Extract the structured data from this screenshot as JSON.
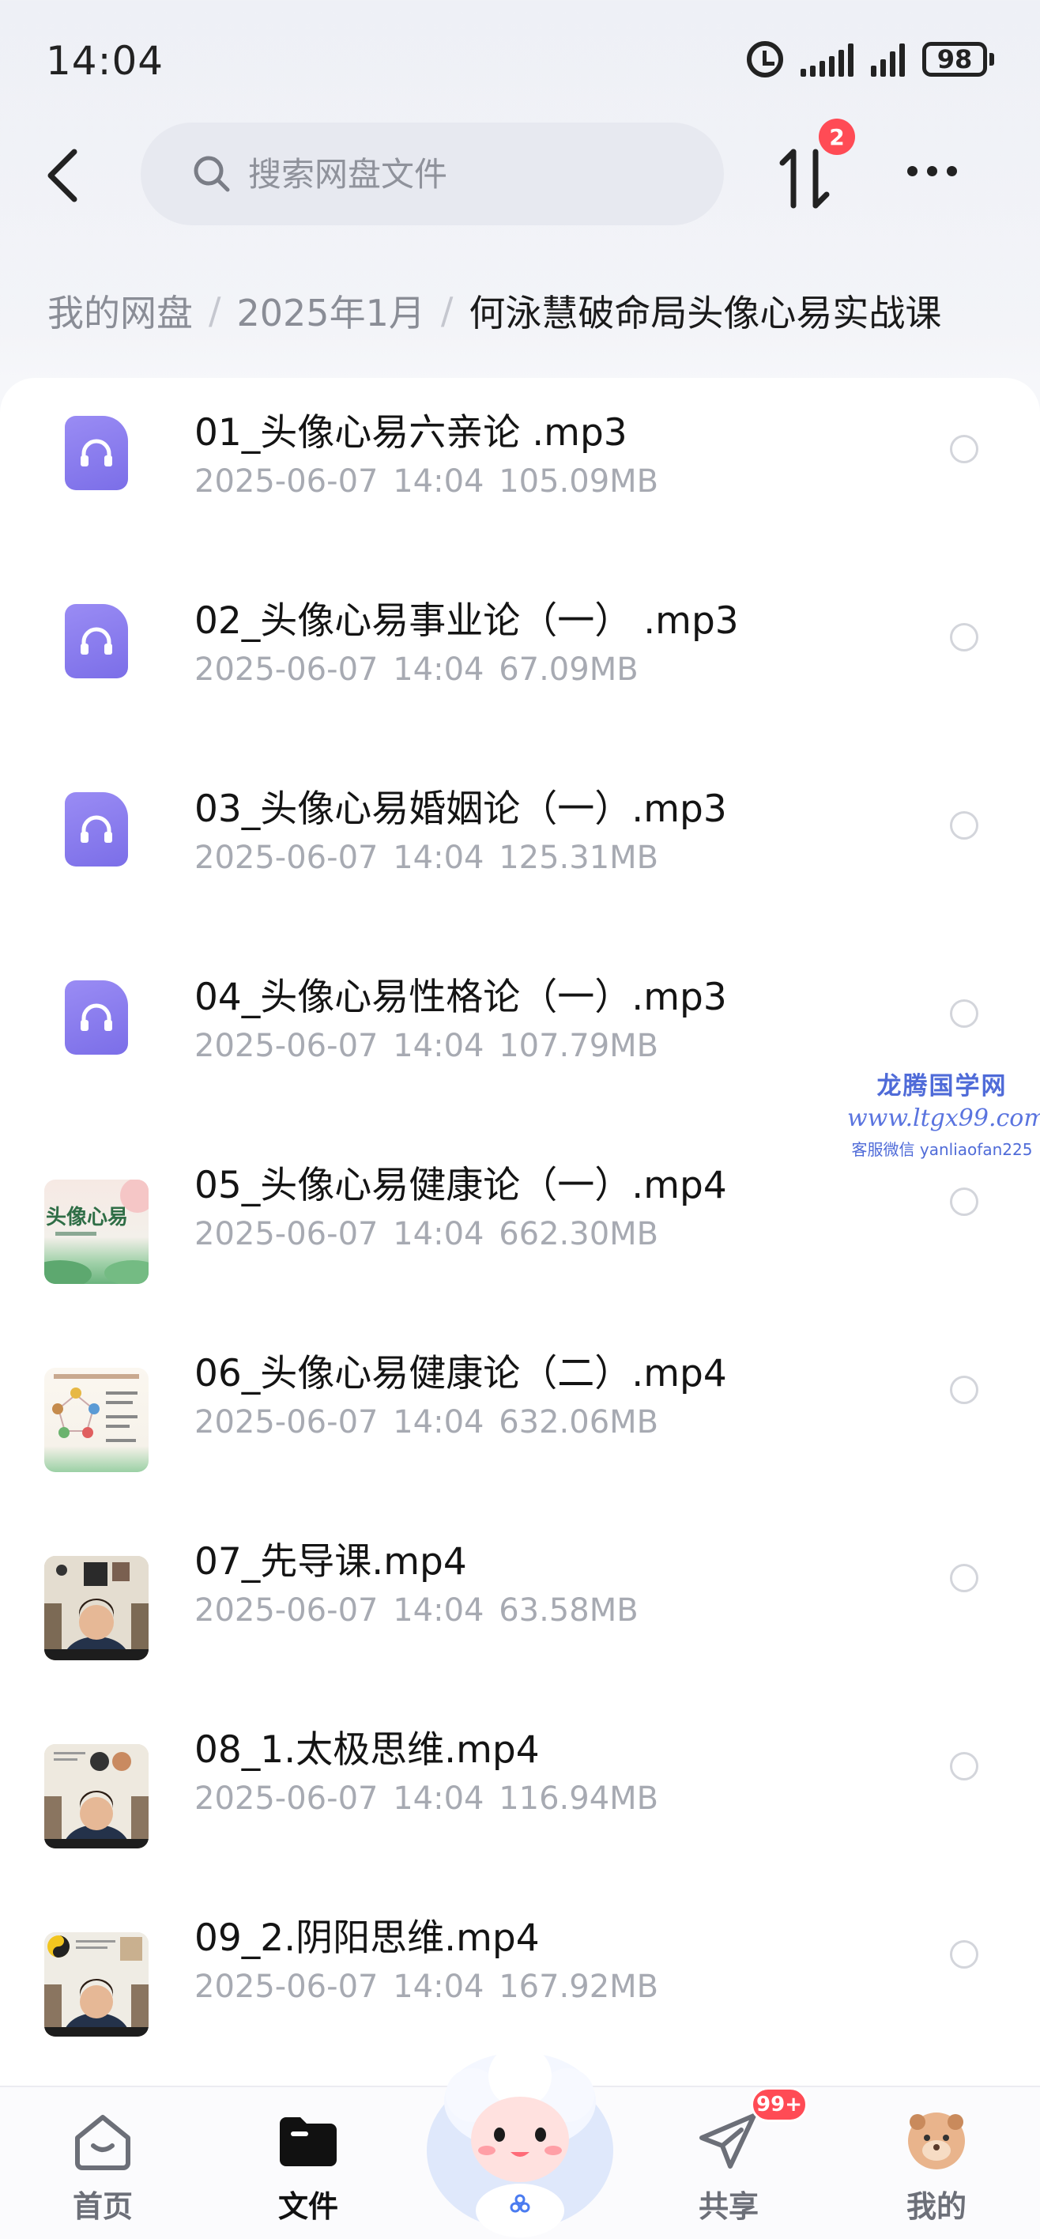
{
  "status_bar": {
    "time": "14:04",
    "battery": "98"
  },
  "header": {
    "search_placeholder": "搜索网盘文件",
    "transfer_badge": "2"
  },
  "breadcrumb": [
    "我的网盘",
    "2025年1月",
    "何泳慧破命局头像心易实战课"
  ],
  "files": [
    {
      "name": "01_头像心易六亲论 .mp3",
      "date": "2025-06-07",
      "time": "14:04",
      "size": "105.09MB",
      "type": "audio"
    },
    {
      "name": "02_头像心易事业论（一） .mp3",
      "date": "2025-06-07",
      "time": "14:04",
      "size": "67.09MB",
      "type": "audio"
    },
    {
      "name": "03_头像心易婚姻论（一）.mp3",
      "date": "2025-06-07",
      "time": "14:04",
      "size": "125.31MB",
      "type": "audio"
    },
    {
      "name": "04_头像心易性格论（一）.mp3",
      "date": "2025-06-07",
      "time": "14:04",
      "size": "107.79MB",
      "type": "audio"
    },
    {
      "name": "05_头像心易健康论（一）.mp4",
      "date": "2025-06-07",
      "time": "14:04",
      "size": "662.30MB",
      "type": "video"
    },
    {
      "name": "06_头像心易健康论（二）.mp4",
      "date": "2025-06-07",
      "time": "14:04",
      "size": "632.06MB",
      "type": "video"
    },
    {
      "name": "07_先导课.mp4",
      "date": "2025-06-07",
      "time": "14:04",
      "size": "63.58MB",
      "type": "video"
    },
    {
      "name": "08_1.太极思维.mp4",
      "date": "2025-06-07",
      "time": "14:04",
      "size": "116.94MB",
      "type": "video"
    },
    {
      "name": "09_2.阴阳思维.mp4",
      "date": "2025-06-07",
      "time": "14:04",
      "size": "167.92MB",
      "type": "video"
    }
  ],
  "watermark": {
    "title": "龙腾国学网",
    "url": "www.ltgx99.com",
    "wechat": "客服微信 yanliaofan225"
  },
  "bottom_nav": {
    "home": "首页",
    "files": "文件",
    "share": "共享",
    "share_badge": "99+",
    "me": "我的"
  },
  "thumb_text": {
    "file05": "头像心易"
  },
  "colors": {
    "audio_icon": "#8b7ef2",
    "badge": "#ff4b55",
    "meta_text": "#a7aab2"
  }
}
